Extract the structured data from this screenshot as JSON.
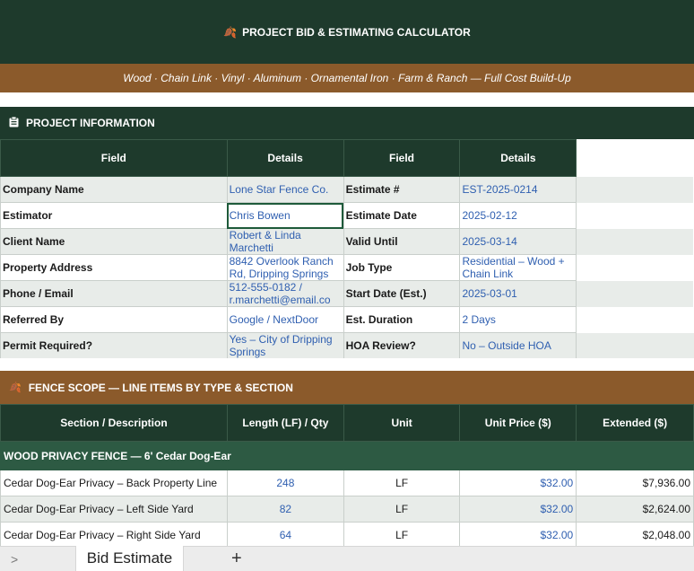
{
  "header": {
    "title": "PROJECT BID & ESTIMATING CALCULATOR",
    "title_icon": "🍂",
    "subtitle": "Wood · Chain Link · Vinyl · Aluminum · Ornamental Iron · Farm & Ranch — Full Cost Build-Up"
  },
  "project_info": {
    "heading": "PROJECT INFORMATION",
    "heading_icon": "clipboard-icon",
    "columns": [
      "Field",
      "Details",
      "Field",
      "Details"
    ],
    "rows": [
      {
        "f1": "Company Name",
        "d1": "Lone Star Fence Co.",
        "f2": "Estimate #",
        "d2": "EST-2025-0214"
      },
      {
        "f1": "Estimator",
        "d1": "Chris Bowen",
        "f2": "Estimate Date",
        "d2": "2025-02-12"
      },
      {
        "f1": "Client Name",
        "d1": "Robert & Linda Marchetti",
        "f2": "Valid Until",
        "d2": "2025-03-14"
      },
      {
        "f1": "Property Address",
        "d1": "8842 Overlook Ranch Rd, Dripping Springs",
        "f2": "Job Type",
        "d2": "Residential – Wood + Chain Link"
      },
      {
        "f1": "Phone / Email",
        "d1": "512-555-0182 / r.marchetti@email.co",
        "f2": "Start Date (Est.)",
        "d2": "2025-03-01"
      },
      {
        "f1": "Referred By",
        "d1": "Google / NextDoor",
        "f2": "Est. Duration",
        "d2": "2 Days"
      },
      {
        "f1": "Permit Required?",
        "d1": "Yes – City of Dripping Springs",
        "f2": "HOA Review?",
        "d2": "No – Outside HOA"
      }
    ]
  },
  "scope": {
    "heading": "FENCE SCOPE — LINE ITEMS BY TYPE & SECTION",
    "heading_icon": "🍂",
    "columns": [
      "Section / Description",
      "Length (LF) / Qty",
      "Unit",
      "Unit Price ($)",
      "Extended ($)"
    ],
    "group": "WOOD PRIVACY FENCE — 6' Cedar Dog-Ear",
    "rows": [
      {
        "desc": "Cedar Dog-Ear Privacy – Back Property Line",
        "qty": "248",
        "unit": "LF",
        "price": "$32.00",
        "ext": "$7,936.00"
      },
      {
        "desc": "Cedar Dog-Ear Privacy – Left Side Yard",
        "qty": "82",
        "unit": "LF",
        "price": "$32.00",
        "ext": "$2,624.00"
      },
      {
        "desc": "Cedar Dog-Ear Privacy – Right Side Yard",
        "qty": "64",
        "unit": "LF",
        "price": "$32.00",
        "ext": "$2,048.00"
      }
    ]
  },
  "sheet_tabs": {
    "active": "Bid Estimate",
    "add_label": "+",
    "nav_label": ">"
  }
}
